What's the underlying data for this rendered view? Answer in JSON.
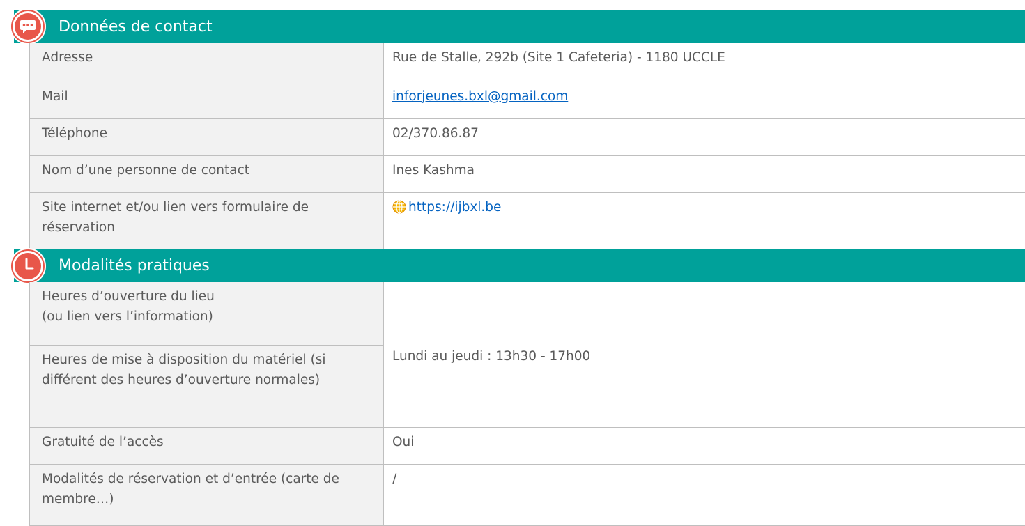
{
  "contact": {
    "title": "Données de contact",
    "icon": "chat-bubble-icon",
    "rows": [
      {
        "label": "Adresse",
        "value": "Rue de Stalle, 292b (Site 1 Cafeteria) - 1180 UCCLE"
      },
      {
        "label": "Mail",
        "value": "inforjeunes.bxl@gmail.com"
      },
      {
        "label": "Téléphone",
        "value": "02/370.86.87"
      },
      {
        "label": "Nom d’une personne de contact",
        "value": "Ines Kashma"
      },
      {
        "label": "Site internet et/ou lien vers formulaire de réservation",
        "value": "https://ijbxl.be",
        "icon": "globe-icon"
      }
    ]
  },
  "practical": {
    "title": "Modalités pratiques",
    "icon": "clock-icon",
    "rows": [
      {
        "label_line1": "Heures d’ouverture du lieu",
        "label_line2": "(ou lien vers l’information)"
      },
      {
        "label": "Heures de mise à disposition du matériel (si différent des heures d’ouverture normales)"
      },
      {
        "label": "Gratuité de l’accès",
        "value": "Oui"
      },
      {
        "label": "Modalités de réservation et d’entrée (carte de membre…)",
        "value": "/"
      }
    ],
    "hours_value": "Lundi au jeudi : 13h30 - 17h00"
  },
  "colors": {
    "header_teal": "#00A19A",
    "icon_red": "#E8574A",
    "label_bg": "#F2F2F2",
    "link_blue": "#0563C1"
  }
}
